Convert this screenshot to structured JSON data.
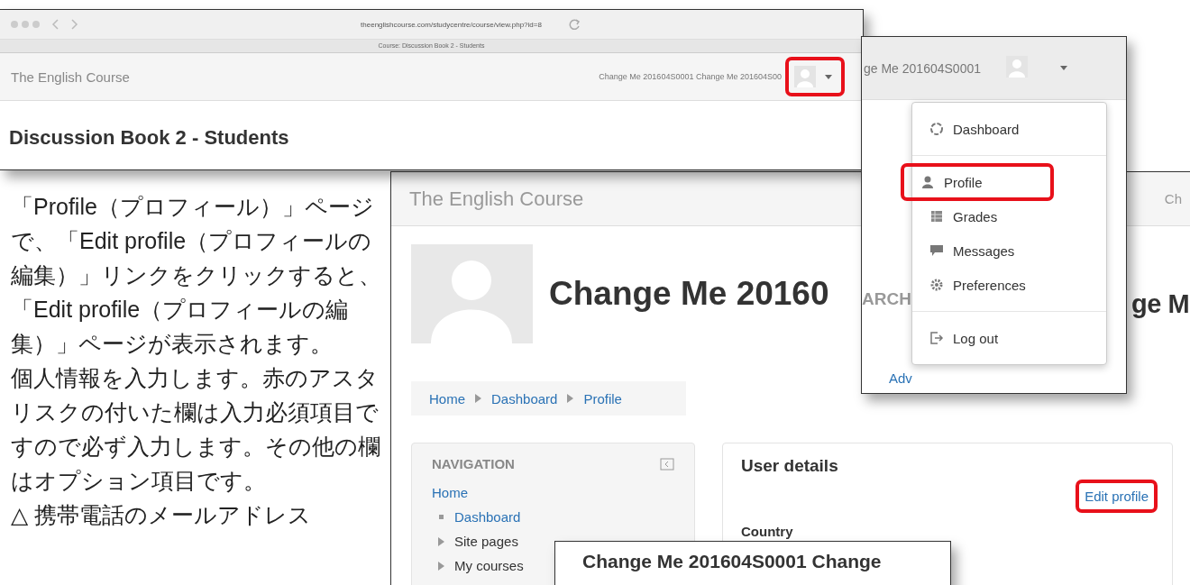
{
  "browser_screenshot": {
    "url": "theenglishcourse.com/studycentre/course/view.php?id=8",
    "tab_title": "Course: Discussion Book 2 - Students",
    "site_name": "The English Course",
    "user_text": "Change Me 201604S0001 Change Me 201604S00",
    "avatar_highlighted": true,
    "page_heading": "Discussion Book 2 - Students"
  },
  "instructions": [
    "「Profile（プロフィール）」ページで、「Edit profile（プロフィールの編集）」リンクをクリックすると、「Edit profile（プロフィールの編集）」ページが表示されます。",
    "個人情報を入力します。赤のアスタリスクの付いた欄は入力必須項目ですので必ず入力します。その他の欄はオプション項目です。",
    "△ 携帯電話のメールアドレス"
  ],
  "profile_screenshot": {
    "site_name": "The English Course",
    "user_text": "Ch",
    "profile_name": "Change Me 20160",
    "profile_name_end": "ge M",
    "breadcrumb": [
      "Home",
      "Dashboard",
      "Profile"
    ],
    "navigation": {
      "title": "NAVIGATION",
      "items": [
        {
          "label": "Home",
          "kind": "link"
        },
        {
          "label": "Dashboard",
          "kind": "leaf"
        },
        {
          "label": "Site pages",
          "kind": "branch"
        },
        {
          "label": "My courses",
          "kind": "branch"
        }
      ]
    },
    "user_details": {
      "title": "User details",
      "edit_link": "Edit profile",
      "edit_highlighted": true,
      "field_label": "Country"
    }
  },
  "name_screenshot": {
    "text": "Change Me 201604S0001 Change"
  },
  "menu_screenshot": {
    "user_text": "ge Me 201604S0001",
    "behind_texts": [
      "ARCH",
      "Adv"
    ],
    "items": [
      {
        "label": "Dashboard",
        "kind": "dashboard",
        "highlighted": false,
        "divider_after": true
      },
      {
        "label": "Profile",
        "kind": "profile",
        "highlighted": true,
        "divider_after": false
      },
      {
        "label": "Grades",
        "kind": "grades",
        "highlighted": false,
        "divider_after": false
      },
      {
        "label": "Messages",
        "kind": "messages",
        "highlighted": false,
        "divider_after": false
      },
      {
        "label": "Preferences",
        "kind": "preferences",
        "highlighted": false,
        "divider_after": true
      },
      {
        "label": "Log out",
        "kind": "logout",
        "highlighted": false,
        "divider_after": false
      }
    ]
  }
}
